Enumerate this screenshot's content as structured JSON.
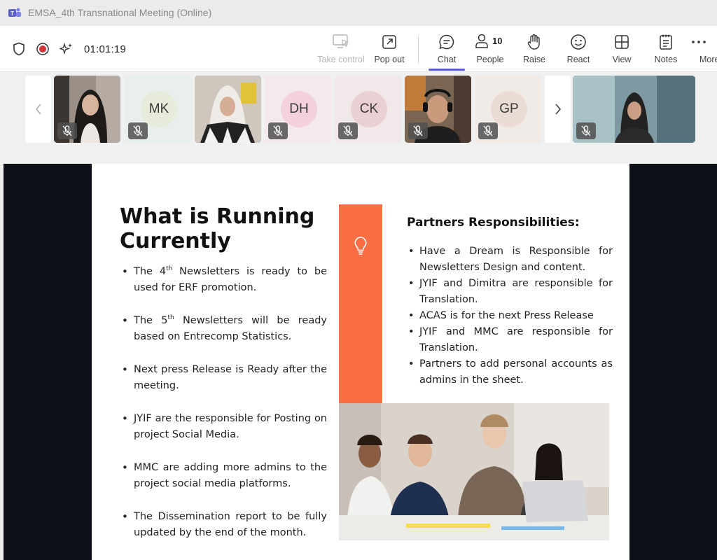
{
  "window": {
    "title": "EMSA_4th Transnational Meeting (Online)",
    "app_icon": "teams-icon"
  },
  "toolbar": {
    "timer": "01:01:19",
    "buttons": {
      "take_control": "Take control",
      "pop_out": "Pop out",
      "chat": "Chat",
      "people": "People",
      "people_count": "10",
      "raise": "Raise",
      "react": "React",
      "view": "View",
      "notes": "Notes",
      "more": "More"
    },
    "accent_color": "#5b5fc7"
  },
  "participants": [
    {
      "type": "video",
      "muted": true
    },
    {
      "type": "avatar",
      "initials": "MK",
      "avatar_color": "#e6ecd9",
      "muted": true
    },
    {
      "type": "video",
      "muted": false,
      "active_speaker": true
    },
    {
      "type": "avatar",
      "initials": "DH",
      "avatar_color": "#f4d2dc",
      "muted": true
    },
    {
      "type": "avatar",
      "initials": "CK",
      "avatar_color": "#ead0d2",
      "muted": true
    },
    {
      "type": "video",
      "muted": true
    },
    {
      "type": "avatar",
      "initials": "GP",
      "avatar_color": "#eadbd5",
      "muted": true
    },
    {
      "type": "video",
      "muted": true
    }
  ],
  "slide": {
    "title": "What is Running Currently",
    "left_items": [
      {
        "pre": "The 4",
        "sup": "th",
        "post": " Newsletters is ready to be used for ERF promotion."
      },
      {
        "pre": "The 5",
        "sup": "th",
        "post": " Newsletters will be ready based on Entrecomp Statistics."
      },
      {
        "pre": "Next press Release is Ready after the meeting.",
        "sup": "",
        "post": ""
      },
      {
        "pre": "JYIF are the responsible for Posting on project Social Media.",
        "sup": "",
        "post": ""
      },
      {
        "pre": "MMC are adding more admins to the project social media platforms.",
        "sup": "",
        "post": ""
      },
      {
        "pre": "The Dissemination report to be fully updated by the end of the month.",
        "sup": "",
        "post": ""
      }
    ],
    "right_title": "Partners Responsibilities:",
    "right_items": [
      "Have a Dream is Responsible for Newsletters Design and content.",
      "JYIF and Dimitra are responsible for Translation.",
      "ACAS is for the next Press Release",
      "JYIF and MMC are responsible for Translation.",
      "Partners to add personal accounts as admins in the sheet."
    ],
    "accent_color": "#fa6e46",
    "icon": "lightbulb-icon"
  }
}
